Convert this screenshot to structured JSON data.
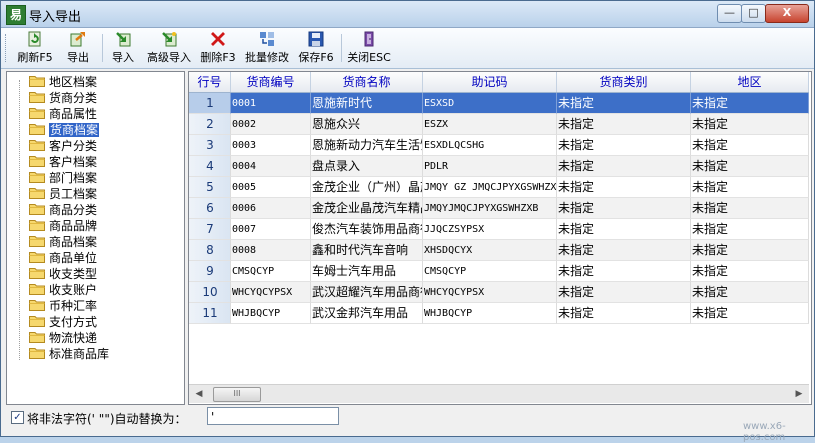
{
  "window": {
    "title": "导入导出",
    "icon_letter": "易",
    "minimize_glyph": "—",
    "maximize_glyph": "□",
    "close_glyph": "X"
  },
  "toolbar": {
    "buttons": [
      {
        "label": "刷新F5",
        "icon": "refresh-icon"
      },
      {
        "label": "导出",
        "icon": "export-icon"
      },
      {
        "label": "导入",
        "icon": "import-icon"
      },
      {
        "label": "高级导入",
        "icon": "advanced-import-icon"
      },
      {
        "label": "删除F3",
        "icon": "delete-icon"
      },
      {
        "label": "批量修改",
        "icon": "batch-edit-icon"
      },
      {
        "label": "保存F6",
        "icon": "save-icon"
      },
      {
        "label": "关闭ESC",
        "icon": "close-door-icon"
      }
    ]
  },
  "tree": {
    "items": [
      "地区档案",
      "货商分类",
      "商品属性",
      "货商档案",
      "客户分类",
      "客户档案",
      "部门档案",
      "员工档案",
      "商品分类",
      "商品品牌",
      "商品档案",
      "商品单位",
      "收支类型",
      "收支账户",
      "币种汇率",
      "支付方式",
      "物流快递",
      "标准商品库"
    ],
    "selected": "货商档案"
  },
  "grid": {
    "columns": [
      "行号",
      "货商编号",
      "货商名称",
      "助记码",
      "货商类别",
      "地区"
    ],
    "rows": [
      [
        "1",
        "0001",
        "恩施新时代",
        "ESXSD",
        "未指定",
        "未指定"
      ],
      [
        "2",
        "0002",
        "恩施众兴",
        "ESZX",
        "未指定",
        "未指定"
      ],
      [
        "3",
        "0003",
        "恩施新动力汽车生活馆",
        "ESXDLQCSHG",
        "未指定",
        "未指定"
      ],
      [
        "4",
        "0004",
        "盘点录入",
        "PDLR",
        "未指定",
        "未指定"
      ],
      [
        "5",
        "0005",
        "金茂企业（广州）晶茂",
        "JMQY GZ JMQCJPYXGSWHZX",
        "未指定",
        "未指定"
      ],
      [
        "6",
        "0006",
        "金茂企业晶茂汽车精品",
        "JMQYJMQCJPYXGSWHZXB",
        "未指定",
        "未指定"
      ],
      [
        "7",
        "0007",
        "俊杰汽车装饰用品商行",
        "JJQCZSYPSX",
        "未指定",
        "未指定"
      ],
      [
        "8",
        "0008",
        "鑫和时代汽车音响",
        "XHSDQCYX",
        "未指定",
        "未指定"
      ],
      [
        "9",
        "CMSQCYP",
        "车姆士汽车用品",
        "CMSQCYP",
        "未指定",
        "未指定"
      ],
      [
        "10",
        "WHCYQCYPSX",
        "武汉超耀汽车用品商行",
        "WHCYQCYPSX",
        "未指定",
        "未指定"
      ],
      [
        "11",
        "WHJBQCYP",
        "武汉金邦汽车用品",
        "WHJBQCYP",
        "未指定",
        "未指定"
      ]
    ],
    "selected_row": 0,
    "scroll_thumb_glyph": "III"
  },
  "footer": {
    "checkbox_checked": true,
    "checkbox_glyph": "✓",
    "label": "将非法字符(' \"\")自动替换为：",
    "replace_value": "'"
  },
  "watermark": "www.x6-pos.com"
}
